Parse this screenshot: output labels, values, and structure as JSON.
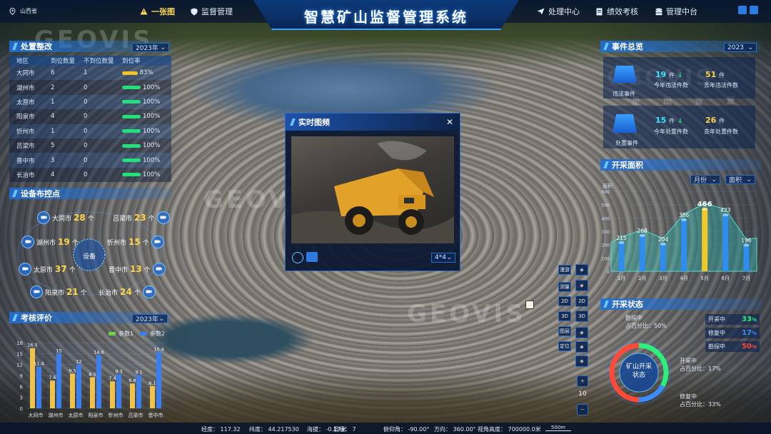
{
  "header": {
    "title": "智慧矿山监督管理系统",
    "region": "山西省",
    "nav_left": [
      {
        "label": "一张图",
        "icon": "warning-icon",
        "active": true
      },
      {
        "label": "监督管理",
        "icon": "shield-icon",
        "active": false
      }
    ],
    "nav_right": [
      {
        "label": "处理中心",
        "icon": "send-icon"
      },
      {
        "label": "绩效考核",
        "icon": "document-icon"
      },
      {
        "label": "管理中台",
        "icon": "database-icon"
      }
    ]
  },
  "watermark": {
    "brand": "GEOVIS",
    "sub": "星 图 智 慧"
  },
  "rectification": {
    "title": "处置整改",
    "year": "2023年",
    "columns": [
      "地区",
      "到位数量",
      "不到位数量",
      "到位率"
    ],
    "rows": [
      {
        "region": "大同市",
        "done": "6",
        "undone": "1",
        "rate": "83%",
        "rate_value": 83
      },
      {
        "region": "湖州市",
        "done": "2",
        "undone": "0",
        "rate": "100%",
        "rate_value": 100
      },
      {
        "region": "太原市",
        "done": "1",
        "undone": "0",
        "rate": "100%",
        "rate_value": 100
      },
      {
        "region": "阳泉市",
        "done": "4",
        "undone": "0",
        "rate": "100%",
        "rate_value": 100
      },
      {
        "region": "忻州市",
        "done": "1",
        "undone": "0",
        "rate": "100%",
        "rate_value": 100
      },
      {
        "region": "吕梁市",
        "done": "5",
        "undone": "0",
        "rate": "100%",
        "rate_value": 100
      },
      {
        "region": "晋中市",
        "done": "3",
        "undone": "0",
        "rate": "100%",
        "rate_value": 100
      },
      {
        "region": "长治市",
        "done": "4",
        "undone": "0",
        "rate": "100%",
        "rate_value": 100
      }
    ]
  },
  "devices": {
    "title": "设备布控点",
    "center": "设备",
    "unit": "个",
    "items": [
      {
        "city": "大同市",
        "count": "28"
      },
      {
        "city": "吕梁市",
        "count": "23"
      },
      {
        "city": "湖州市",
        "count": "19"
      },
      {
        "city": "忻州市",
        "count": "15"
      },
      {
        "city": "太原市",
        "count": "37"
      },
      {
        "city": "晋中市",
        "count": "13"
      },
      {
        "city": "阳泉市",
        "count": "21"
      },
      {
        "city": "长治市",
        "count": "24"
      }
    ]
  },
  "assessment": {
    "title": "考核评价",
    "year": "2023年",
    "colors": {
      "s1": "#f1c24a",
      "s2": "#3b7ef0"
    }
  },
  "video": {
    "title": "实时图频",
    "layout": "4*4"
  },
  "events": {
    "title": "事件总览",
    "year": "2023",
    "violations": {
      "label": "违法事件",
      "this_year": "19",
      "this_year_unit": "件",
      "this_year_label": "今年违法件数",
      "last_year": "51",
      "last_year_unit": "件",
      "last_year_label": "去年违法件数"
    },
    "disposals": {
      "label": "处置事件",
      "this_year": "15",
      "this_year_unit": "件",
      "this_year_label": "今年处置件数",
      "last_year": "26",
      "last_year_unit": "件",
      "last_year_label": "去年处置件数"
    }
  },
  "mining_area": {
    "title": "开采面积",
    "period": "月份",
    "metric": "面积",
    "ylabel": "面积"
  },
  "mining_status": {
    "title": "开采状态",
    "center": "矿山开采状态",
    "legend": [
      {
        "label": "开采中",
        "value": "33",
        "unit": "%",
        "color": "#2bf07b"
      },
      {
        "label": "修复中",
        "value": "17",
        "unit": "%",
        "color": "#3b8cff"
      },
      {
        "label": "勘探中",
        "value": "50",
        "unit": "%",
        "color": "#ff4a3a"
      }
    ],
    "callouts": [
      {
        "label": "勘探中",
        "share": "占百分比：50%"
      },
      {
        "label": "开采中",
        "share": "占百分比：17%"
      },
      {
        "label": "修复中",
        "share": "占百分比：33%"
      }
    ]
  },
  "map_tools": {
    "left": [
      "漫游",
      "测量",
      "2D",
      "3D",
      "图层",
      "定位"
    ],
    "right": [
      "2D",
      "3D"
    ],
    "zoom": "10"
  },
  "status_bar": {
    "items": [
      {
        "k": "经度",
        "v": "117.32"
      },
      {
        "k": "纬度",
        "v": "44.217530"
      },
      {
        "k": "海拔",
        "v": "-0.17米"
      },
      {
        "k": "层级",
        "v": "7"
      },
      {
        "k": "俯仰角",
        "v": "-90.00°"
      },
      {
        "k": "方向",
        "v": "360.00°"
      },
      {
        "k": "视角高度",
        "v": "700000.0米"
      }
    ],
    "scale": "500m"
  },
  "chart_data": [
    {
      "type": "bar",
      "title": "考核评价",
      "categories": [
        "大同市",
        "湖州市",
        "太原市",
        "阳泉市",
        "忻州市",
        "吕梁市",
        "晋中市"
      ],
      "series": [
        {
          "name": "参数1",
          "values": [
            16.5,
            7.6,
            9.5,
            8.5,
            7.4,
            6.8,
            6.1
          ]
        },
        {
          "name": "参数2",
          "values": [
            11.4,
            15.0,
            12.0,
            14.6,
            9.3,
            9.1,
            15.4
          ]
        }
      ],
      "ylim": [
        0,
        18
      ],
      "yticks": [
        0,
        3,
        6,
        9,
        12,
        15,
        18
      ],
      "legend": "top-right"
    },
    {
      "type": "bar",
      "title": "开采面积",
      "categories": [
        "1月",
        "2月",
        "3月",
        "4月",
        "5月",
        "6月",
        "7月"
      ],
      "values": [
        215,
        268,
        204,
        386,
        466,
        423,
        196
      ],
      "ylabel": "面积",
      "ylim": [
        0,
        600
      ],
      "yticks": [
        0,
        100,
        200,
        300,
        400,
        500,
        600
      ],
      "highlight_index": 4
    }
  ]
}
